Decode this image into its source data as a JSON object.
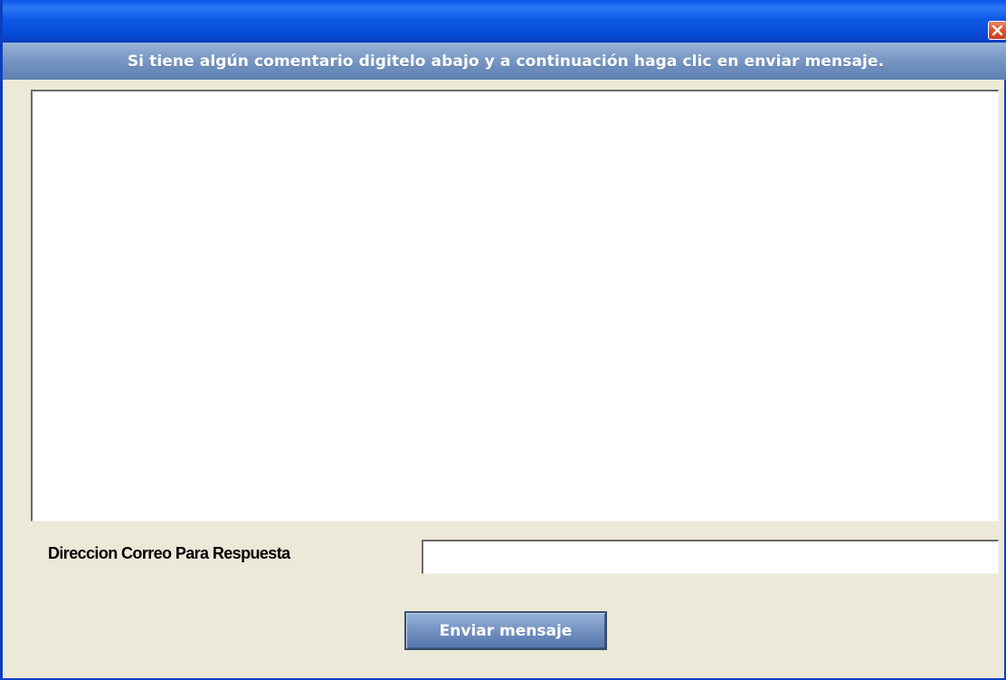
{
  "titlebar": {
    "title": "",
    "close_icon": "close-icon"
  },
  "header": {
    "message": "Si tiene algún comentario digitelo abajo y a continuación haga clic en enviar mensaje."
  },
  "comment": {
    "value": "",
    "placeholder": ""
  },
  "email": {
    "label": "Direccion Correo Para Respuesta",
    "value": "",
    "placeholder": ""
  },
  "send_button": {
    "label": "Enviar mensaje"
  },
  "colors": {
    "titlebar": "#0a56e8",
    "banner": "#7e9dc8",
    "window_bg": "#ece9d8",
    "close_button": "#d8542c"
  }
}
